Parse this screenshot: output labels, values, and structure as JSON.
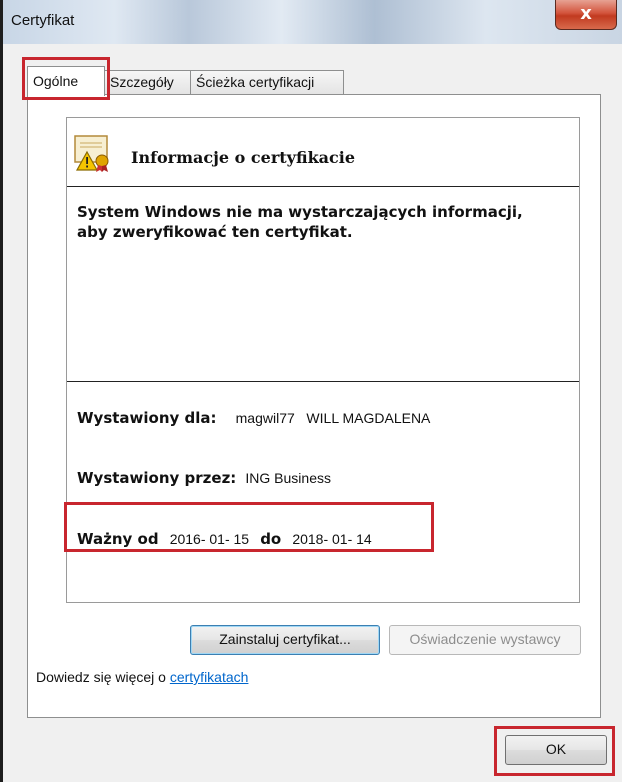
{
  "window": {
    "title": "Certyfikat",
    "close_label": "x"
  },
  "tabs": [
    {
      "label": "Ogólne",
      "active": true
    },
    {
      "label": "Szczegóły",
      "active": false
    },
    {
      "label": "Ścieżka certyfikacji",
      "active": false
    }
  ],
  "general": {
    "icon": "certificate-warning-icon",
    "section_title": "Informacje o certyfikacie",
    "warning_text": "System Windows nie ma wystarczających informacji, aby zweryfikować ten certyfikat.",
    "issued_to_label": "Wystawiony dla:",
    "issued_to_value": "magwil77   WILL MAGDALENA",
    "issued_by_label": "Wystawiony przez:",
    "issued_by_value": "ING Business",
    "valid_from_label": "Ważny od",
    "valid_from_value": "2016- 01- 15",
    "valid_to_label": "do",
    "valid_to_value": "2018- 01- 14"
  },
  "buttons": {
    "install_label": "Zainstaluj certyfikat...",
    "issuer_statement_label": "Oświadczenie wystawcy",
    "ok_label": "OK"
  },
  "learn_more": {
    "prefix": "Dowiedz się więcej o ",
    "link_text": "certyfikatach"
  },
  "colors": {
    "highlight": "#c8262e",
    "link": "#0066cc"
  }
}
